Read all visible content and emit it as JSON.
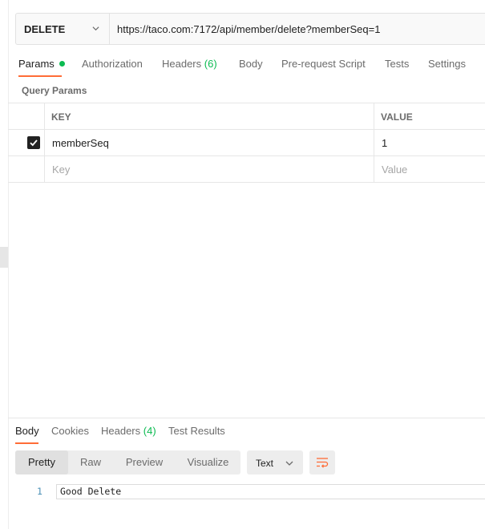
{
  "request": {
    "method": "DELETE",
    "url": "https://taco.com:7172/api/member/delete?memberSeq=1"
  },
  "request_tabs": [
    {
      "label": "Params"
    },
    {
      "label": "Authorization"
    },
    {
      "label": "Headers",
      "count": "(6)"
    },
    {
      "label": "Body"
    },
    {
      "label": "Pre-request Script"
    },
    {
      "label": "Tests"
    },
    {
      "label": "Settings"
    }
  ],
  "query_params": {
    "title": "Query Params",
    "headers": {
      "key": "KEY",
      "value": "VALUE"
    },
    "rows": [
      {
        "checked": true,
        "key": "memberSeq",
        "value": "1"
      }
    ],
    "placeholder": {
      "key": "Key",
      "value": "Value"
    }
  },
  "response_tabs": [
    {
      "label": "Body"
    },
    {
      "label": "Cookies"
    },
    {
      "label": "Headers",
      "count": "(4)"
    },
    {
      "label": "Test Results"
    }
  ],
  "view_modes": [
    "Pretty",
    "Raw",
    "Preview",
    "Visualize"
  ],
  "format": {
    "selected": "Text"
  },
  "response_body": {
    "lines": [
      {
        "number": "1",
        "text": "Good Delete"
      }
    ]
  },
  "colors": {
    "accent": "#ff6c37",
    "success": "#0cbb52"
  },
  "icons": [
    "chevron-down-icon",
    "status-dot-icon",
    "checkbox-checked-icon",
    "wrap-lines-icon"
  ]
}
